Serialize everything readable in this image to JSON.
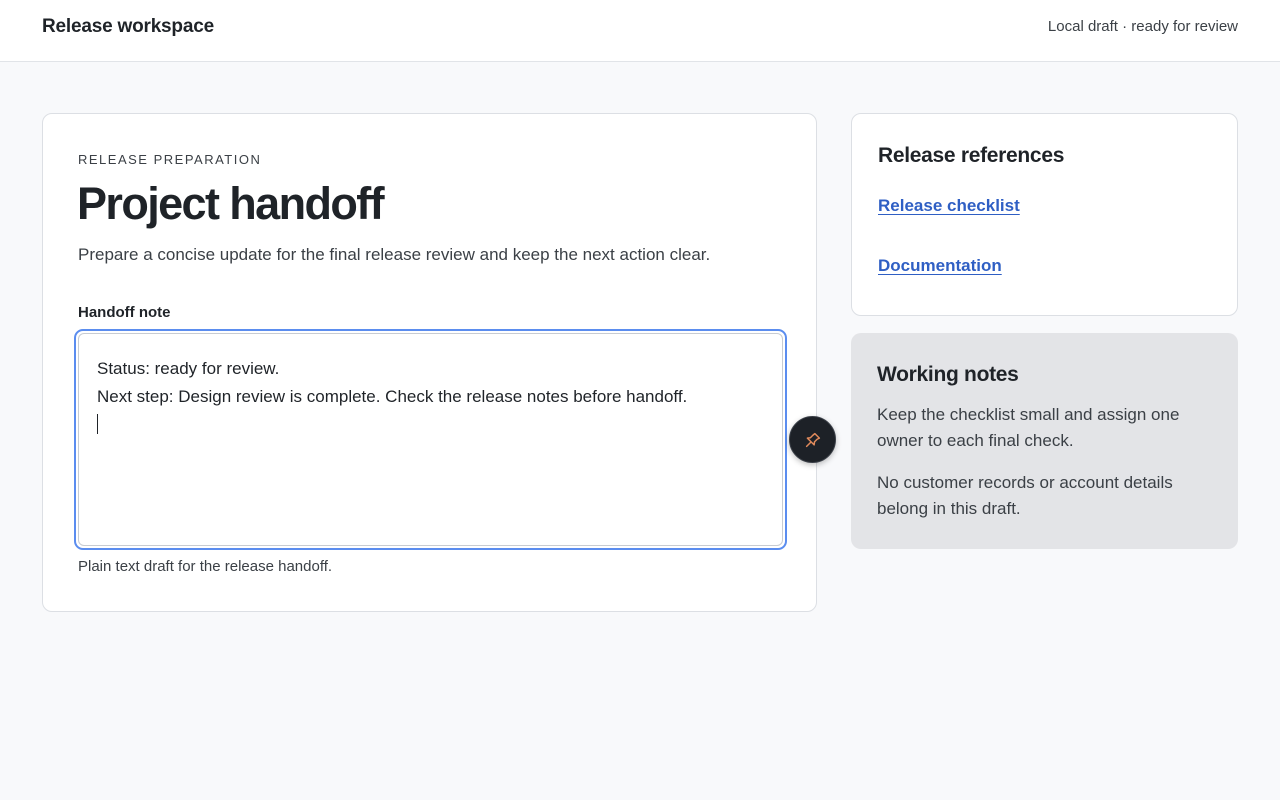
{
  "header": {
    "title": "Release workspace",
    "status": "Local draft · ready for review"
  },
  "main": {
    "eyebrow": "RELEASE PREPARATION",
    "title": "Project handoff",
    "description": "Prepare a concise update for the final release review and keep the next action clear.",
    "field_label": "Handoff note",
    "note_lines": [
      "Status: ready for review.",
      "Next step: Design review is complete. Check the release notes before handoff."
    ],
    "helper": "Plain text draft for the release handoff."
  },
  "pin_button": {
    "icon": "pin-icon",
    "icon_color": "#e08a5c"
  },
  "references": {
    "title": "Release references",
    "links": [
      {
        "label": "Release checklist"
      },
      {
        "label": "Documentation"
      }
    ]
  },
  "working_notes": {
    "title": "Working notes",
    "paragraphs": [
      "Keep the checklist small and assign one owner to each final check.",
      "No customer records or account details belong in this draft."
    ]
  },
  "colors": {
    "accent": "#5b8def",
    "link": "#2f5fc4"
  }
}
